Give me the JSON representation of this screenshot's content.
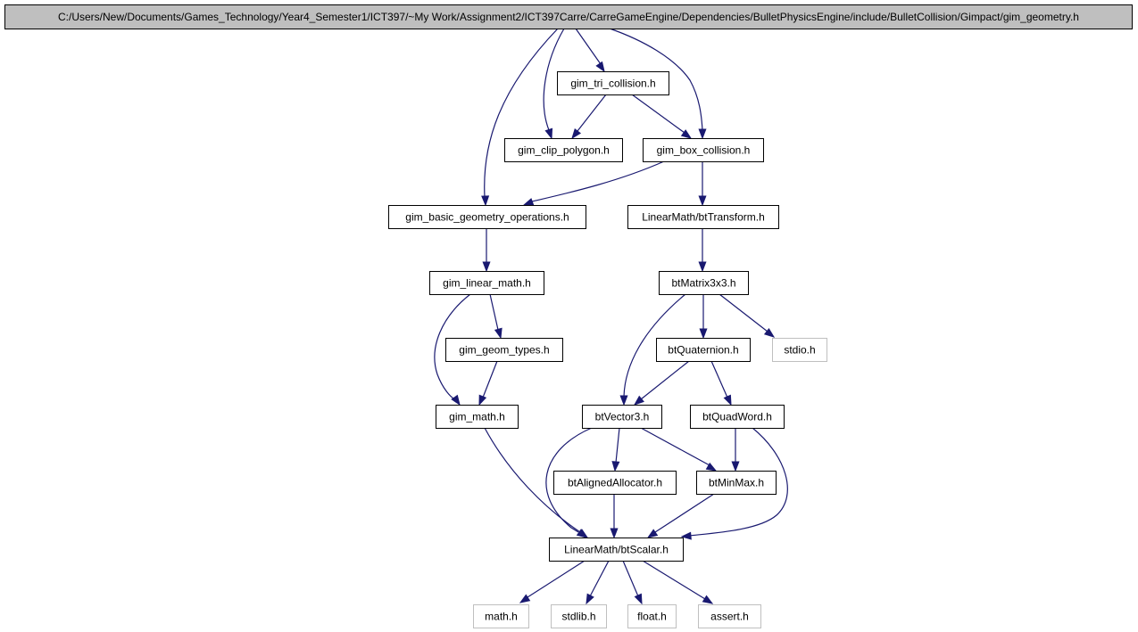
{
  "colors": {
    "edge": "#191970",
    "node_border": "#000000",
    "external_border": "#bfbfbf",
    "root_fill": "#bfbfbf",
    "node_fill": "#ffffff"
  },
  "nodes": [
    {
      "id": "root",
      "label": "C:/Users/New/Documents/Games_Technology/Year4_Semester1/ICT397/~My Work/Assignment2/ICT397Carre/CarreGameEngine/Dependencies/BulletPhysicsEngine/include/BulletCollision/Gimpact/gim_geometry.h",
      "kind": "root"
    },
    {
      "id": "tri",
      "label": "gim_tri_collision.h",
      "kind": "internal"
    },
    {
      "id": "clip",
      "label": "gim_clip_polygon.h",
      "kind": "internal"
    },
    {
      "id": "box",
      "label": "gim_box_collision.h",
      "kind": "internal"
    },
    {
      "id": "basic",
      "label": "gim_basic_geometry_operations.h",
      "kind": "internal"
    },
    {
      "id": "transform",
      "label": "LinearMath/btTransform.h",
      "kind": "internal"
    },
    {
      "id": "linear",
      "label": "gim_linear_math.h",
      "kind": "internal"
    },
    {
      "id": "matrix",
      "label": "btMatrix3x3.h",
      "kind": "internal"
    },
    {
      "id": "geomtypes",
      "label": "gim_geom_types.h",
      "kind": "internal"
    },
    {
      "id": "quat",
      "label": "btQuaternion.h",
      "kind": "internal"
    },
    {
      "id": "stdio",
      "label": "stdio.h",
      "kind": "external"
    },
    {
      "id": "gmath",
      "label": "gim_math.h",
      "kind": "internal"
    },
    {
      "id": "vec3",
      "label": "btVector3.h",
      "kind": "internal"
    },
    {
      "id": "quadword",
      "label": "btQuadWord.h",
      "kind": "internal"
    },
    {
      "id": "aligned",
      "label": "btAlignedAllocator.h",
      "kind": "internal"
    },
    {
      "id": "minmax",
      "label": "btMinMax.h",
      "kind": "internal"
    },
    {
      "id": "scalar",
      "label": "LinearMath/btScalar.h",
      "kind": "internal"
    },
    {
      "id": "math",
      "label": "math.h",
      "kind": "external"
    },
    {
      "id": "stdlib",
      "label": "stdlib.h",
      "kind": "external"
    },
    {
      "id": "float",
      "label": "float.h",
      "kind": "external"
    },
    {
      "id": "assert",
      "label": "assert.h",
      "kind": "external"
    }
  ],
  "edges": [
    {
      "from": "root",
      "to": "tri"
    },
    {
      "from": "root",
      "to": "clip"
    },
    {
      "from": "root",
      "to": "box"
    },
    {
      "from": "root",
      "to": "basic"
    },
    {
      "from": "tri",
      "to": "clip"
    },
    {
      "from": "tri",
      "to": "box"
    },
    {
      "from": "box",
      "to": "basic"
    },
    {
      "from": "box",
      "to": "transform"
    },
    {
      "from": "basic",
      "to": "linear"
    },
    {
      "from": "transform",
      "to": "matrix"
    },
    {
      "from": "linear",
      "to": "geomtypes"
    },
    {
      "from": "linear",
      "to": "gmath"
    },
    {
      "from": "geomtypes",
      "to": "gmath"
    },
    {
      "from": "matrix",
      "to": "quat"
    },
    {
      "from": "matrix",
      "to": "stdio"
    },
    {
      "from": "matrix",
      "to": "vec3"
    },
    {
      "from": "quat",
      "to": "vec3"
    },
    {
      "from": "quat",
      "to": "quadword"
    },
    {
      "from": "gmath",
      "to": "scalar"
    },
    {
      "from": "vec3",
      "to": "aligned"
    },
    {
      "from": "vec3",
      "to": "minmax"
    },
    {
      "from": "vec3",
      "to": "scalar"
    },
    {
      "from": "quadword",
      "to": "minmax"
    },
    {
      "from": "quadword",
      "to": "scalar"
    },
    {
      "from": "aligned",
      "to": "scalar"
    },
    {
      "from": "minmax",
      "to": "scalar"
    },
    {
      "from": "scalar",
      "to": "math"
    },
    {
      "from": "scalar",
      "to": "stdlib"
    },
    {
      "from": "scalar",
      "to": "float"
    },
    {
      "from": "scalar",
      "to": "assert"
    }
  ]
}
